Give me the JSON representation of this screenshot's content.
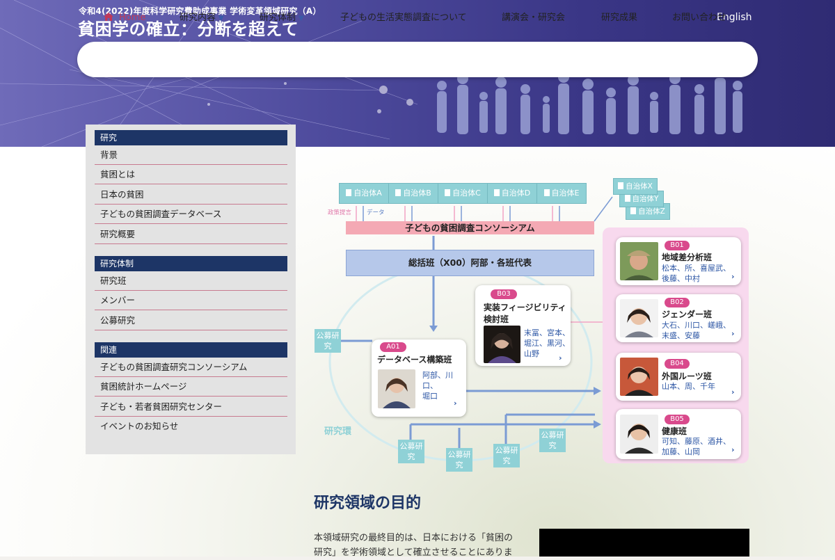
{
  "header": {
    "subtitle": "令和4(2022)年度科学研究費助成事業 学術変革領域研究（A）",
    "title": "貧困学の確立：分断を超えて",
    "language_link": "English"
  },
  "nav": {
    "home": "Home",
    "research": "研究内容",
    "structure": "研究体制",
    "survey": "子どもの生活実態調査について",
    "events": "講演会・研究会",
    "results": "研究成果",
    "contact": "お問い合わせ"
  },
  "sidebar": {
    "sections": [
      {
        "heading": "研究",
        "items": [
          "背景",
          "貧困とは",
          "日本の貧困",
          "子どもの貧困調査データベース",
          "研究概要"
        ]
      },
      {
        "heading": "研究体制",
        "items": [
          "研究班",
          "メンバー",
          "公募研究"
        ]
      },
      {
        "heading": "関連",
        "items": [
          "子どもの貧困調査研究コンソーシアム",
          "貧困統計ホームページ",
          "子ども・若者貧困研究センター",
          "イベントのお知らせ"
        ]
      }
    ]
  },
  "diagram": {
    "municipalities": [
      "自治体A",
      "自治体B",
      "自治体C",
      "自治体D",
      "自治体E"
    ],
    "municipalities_stack": [
      "自治体X",
      "自治体Y",
      "自治体Z"
    ],
    "label_policy": "政策提言",
    "label_data": "データ",
    "consortium": "子どもの貧困調査コンソーシアム",
    "general_group": "総括班（X00）阿部・各班代表",
    "ring_label": "研究環",
    "open_research": "公募研究",
    "groups": {
      "a01": {
        "code": "A01",
        "title": "データベース構築班",
        "members": [
          "阿部、川口、",
          "堀口"
        ]
      },
      "b03": {
        "code": "B03",
        "title_l1": "実装フィージビリティ",
        "title_l2": "検討班",
        "members": [
          "末冨、宮本、",
          "堀江、黒河、",
          "山野"
        ]
      },
      "b01": {
        "code": "B01",
        "title": "地域差分析班",
        "members": [
          "松本、所、喜屋武、",
          "後藤、中村"
        ]
      },
      "b02": {
        "code": "B02",
        "title": "ジェンダー班",
        "members": [
          "大石、川口、嵯峨、",
          "末盛、安藤"
        ]
      },
      "b04": {
        "code": "B04",
        "title": "外国ルーツ班",
        "members": [
          "山本、周、千年"
        ]
      },
      "b05": {
        "code": "B05",
        "title": "健康班",
        "members": [
          "可知、藤原、酒井、",
          "加藤、山岡"
        ]
      }
    },
    "arrow": "›"
  },
  "main": {
    "section_title": "研究領域の目的",
    "body_l1": "本領域研究の最終目的は、日本における「貧困の",
    "body_l2": "研究」を学術領域として確立させることにありま"
  },
  "colors": {
    "header_start": "#6f6bb9",
    "header_end": "#2f2b73",
    "accent_pink": "#d94a8c",
    "navy": "#1d3566",
    "teal": "#8fd1d6",
    "member_blue": "#2e57a5"
  }
}
